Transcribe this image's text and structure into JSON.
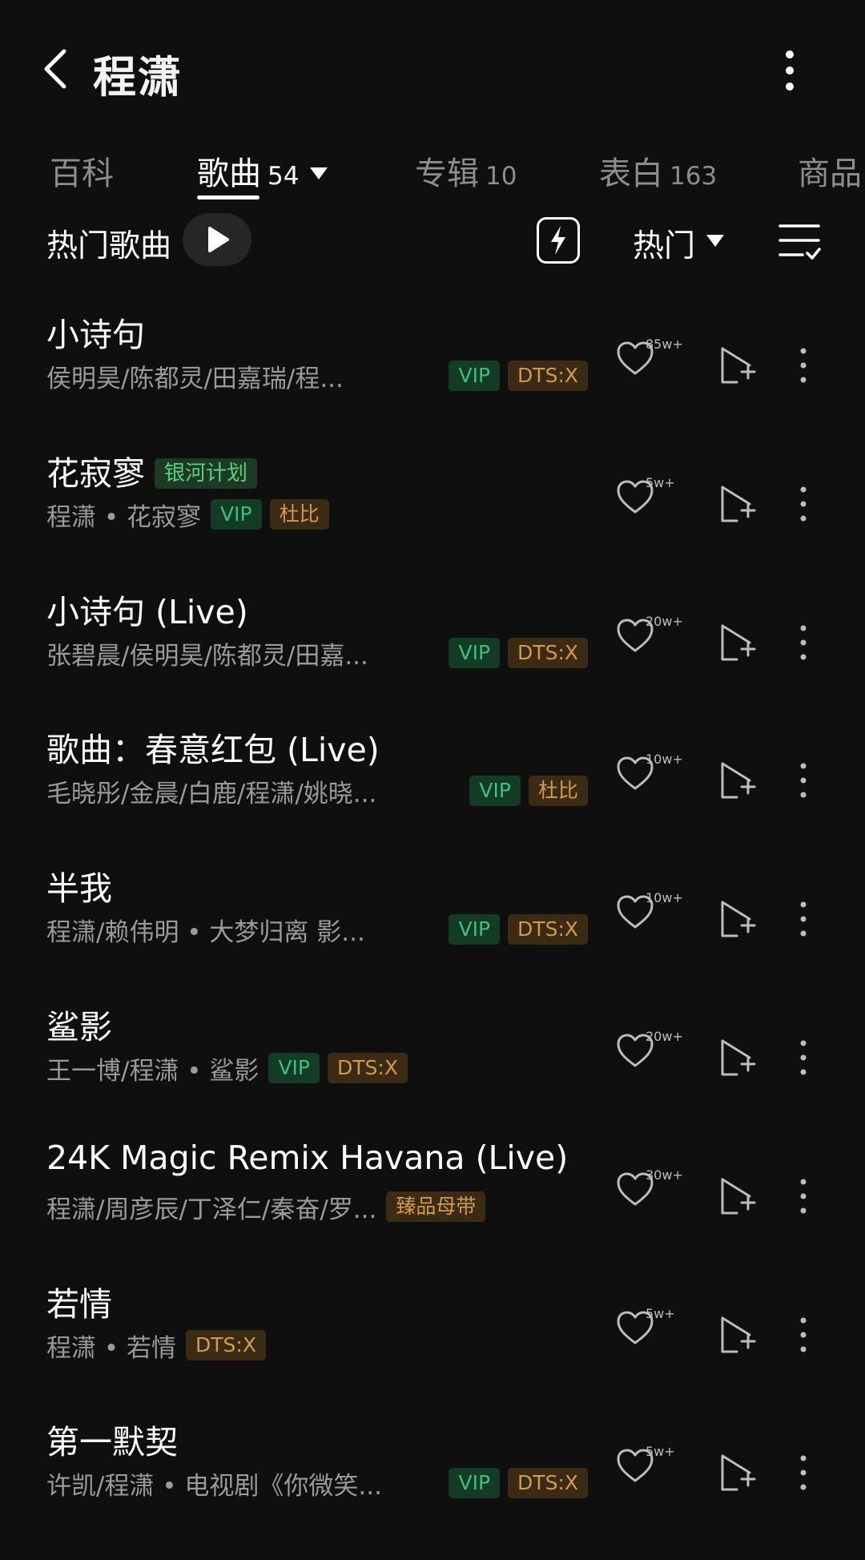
{
  "header": {
    "title": "程潇"
  },
  "tabs": [
    {
      "label": "百科",
      "count": ""
    },
    {
      "label": "歌曲",
      "count": "54"
    },
    {
      "label": "专辑",
      "count": "10"
    },
    {
      "label": "表白",
      "count": "163"
    },
    {
      "label": "商品",
      "count": ""
    }
  ],
  "toolbar": {
    "hot_label": "热门歌曲",
    "sort_label": "热门"
  },
  "songs": [
    {
      "title": "小诗句",
      "artists": "侯明昊/陈都灵/田嘉瑞/程...",
      "badges": [
        "VIP",
        "DTS:X"
      ],
      "likes": "85w+"
    },
    {
      "title": "花寂寥",
      "title_tag": "银河计划",
      "artists": "程潇 • 花寂寥",
      "badges": [
        "VIP",
        "杜比"
      ],
      "likes": "5w+"
    },
    {
      "title": "小诗句 (Live)",
      "artists": "张碧晨/侯明昊/陈都灵/田嘉...",
      "badges": [
        "VIP",
        "DTS:X"
      ],
      "likes": "20w+"
    },
    {
      "title": "歌曲：春意红包 (Live)",
      "artists": "毛晓彤/金晨/白鹿/程潇/姚晓...",
      "badges": [
        "VIP",
        "杜比"
      ],
      "likes": "10w+"
    },
    {
      "title": "半我",
      "artists": "程潇/赖伟明 • 大梦归离 影...",
      "badges": [
        "VIP",
        "DTS:X"
      ],
      "likes": "10w+"
    },
    {
      "title": "鲨影",
      "artists": "王一博/程潇 • 鲨影",
      "badges": [
        "VIP",
        "DTS:X"
      ],
      "likes": "20w+"
    },
    {
      "title": "24K Magic Remix Havana (Live)",
      "artists": "程潇/周彦辰/丁泽仁/秦奋/罗...",
      "badges": [
        "臻品母带"
      ],
      "likes": "30w+"
    },
    {
      "title": "若情",
      "artists": "程潇 • 若情",
      "badges": [
        "DTS:X"
      ],
      "likes": "5w+"
    },
    {
      "title": "第一默契",
      "artists": "许凯/程潇 • 电视剧《你微笑...",
      "badges": [
        "VIP",
        "DTS:X"
      ],
      "likes": "5w+"
    }
  ],
  "icons": {
    "back": "chevron-left-icon",
    "more": "vertical-dots-icon",
    "play": "play-icon",
    "bolt": "lightning-icon",
    "multiselect": "list-check-icon",
    "like": "heart-icon",
    "add": "add-to-playlist-icon"
  }
}
